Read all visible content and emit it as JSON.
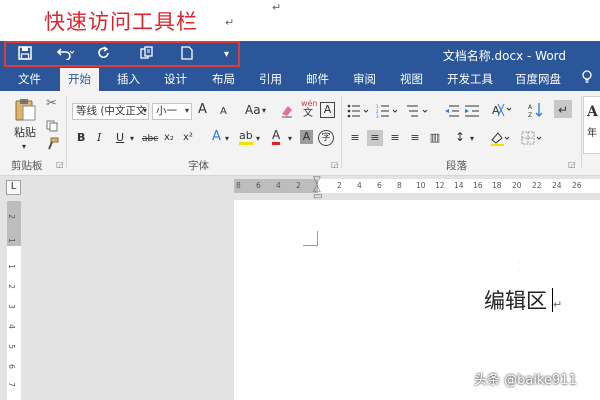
{
  "annotation": {
    "title": "快速访问工具栏",
    "para_mark": "↵"
  },
  "qat": {
    "save_icon": "save-icon",
    "undo_icon": "undo-icon",
    "redo_icon": "redo-icon",
    "new_icon": "new-document-icon",
    "customize_icon": "customize-qat-icon"
  },
  "window": {
    "title": "文档名称.docx - Word"
  },
  "tabs": [
    {
      "label": "文件"
    },
    {
      "label": "开始"
    },
    {
      "label": "插入"
    },
    {
      "label": "设计"
    },
    {
      "label": "布局"
    },
    {
      "label": "引用"
    },
    {
      "label": "邮件"
    },
    {
      "label": "审阅"
    },
    {
      "label": "视图"
    },
    {
      "label": "开发工具"
    },
    {
      "label": "百度网盘"
    }
  ],
  "ribbon": {
    "clipboard": {
      "paste_label": "粘贴",
      "group_label": "剪贴板"
    },
    "font": {
      "font_name": "等线 (中文正文",
      "font_size": "小一",
      "grow": "A",
      "shrink": "A",
      "change_case": "Aa",
      "pinyin_top": "wén",
      "pinyin_bottom": "文",
      "border_char": "A",
      "bold": "B",
      "italic": "I",
      "underline": "U",
      "strikethrough": "abc",
      "subscript": "x₂",
      "superscript": "x²",
      "text_effects": "A",
      "highlight": "ab",
      "font_color": "A",
      "shading": "A",
      "enclose": "字",
      "group_label": "字体"
    },
    "paragraph": {
      "group_label": "段落",
      "line_spacing": "↕",
      "sort": "A↓Z"
    },
    "styles": {
      "preview": "A",
      "preview2": "年"
    }
  },
  "ruler": {
    "h_numbers": [
      "8",
      "6",
      "4",
      "2",
      "2",
      "4",
      "6",
      "8",
      "10",
      "12",
      "14",
      "16",
      "18",
      "20",
      "22",
      "24",
      "26"
    ],
    "v_numbers": [
      "2",
      "1",
      "1",
      "2",
      "3",
      "4",
      "5",
      "6",
      "7",
      "8",
      "9",
      "10"
    ],
    "corner": "L"
  },
  "document": {
    "text": "编辑区"
  },
  "watermark": "头条 @baike911",
  "colors": {
    "title_bar": "#2b579a",
    "annotation": "#d9262e",
    "highlight_box": "#e03a3a"
  }
}
